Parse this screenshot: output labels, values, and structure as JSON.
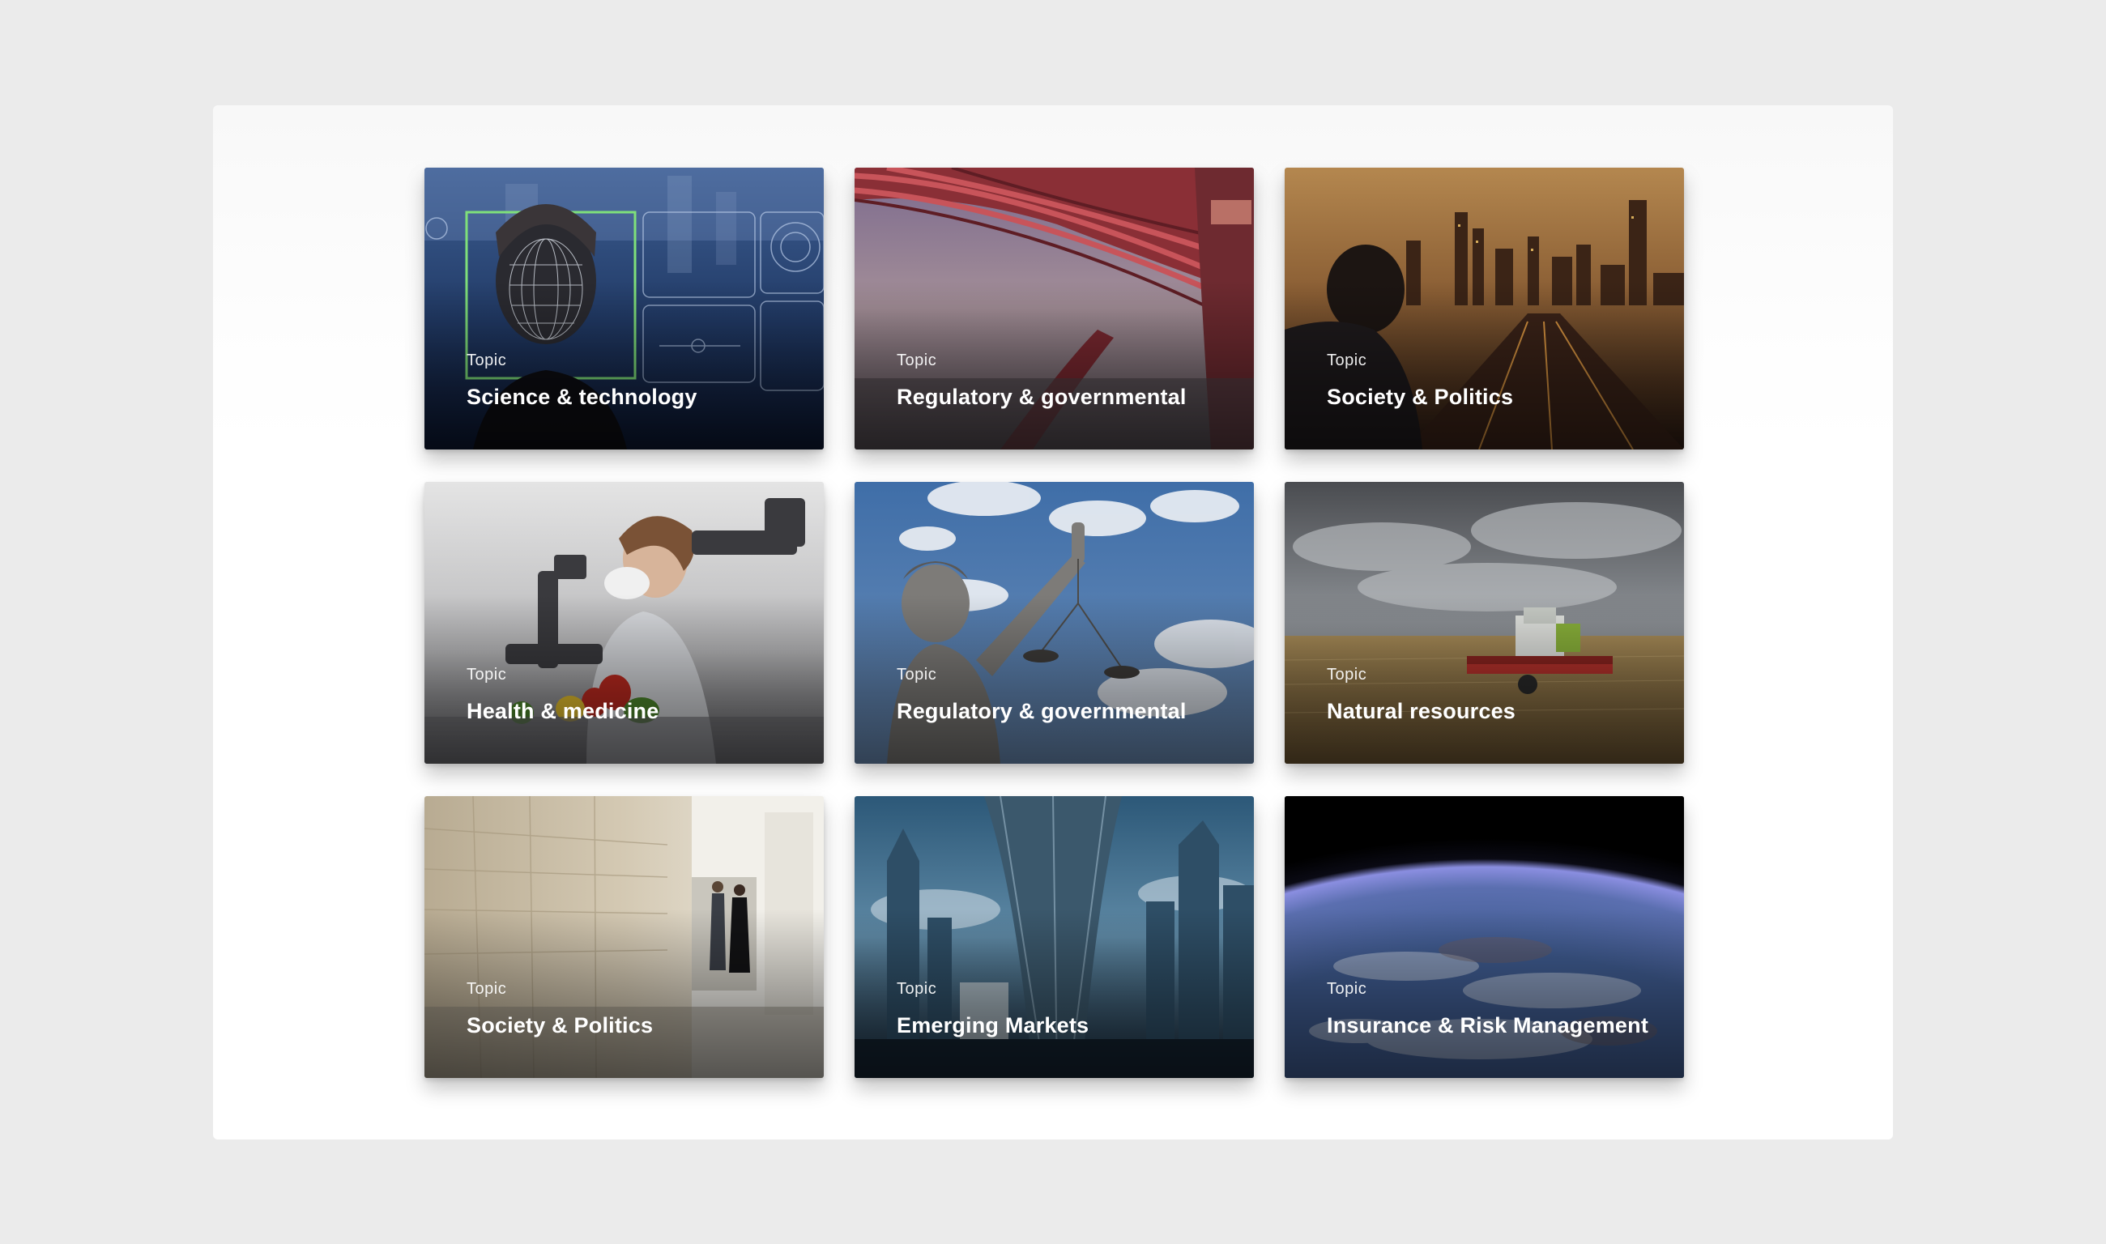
{
  "cards": [
    {
      "label": "Topic",
      "title": "Science & technology"
    },
    {
      "label": "Topic",
      "title": "Regulatory & governmental"
    },
    {
      "label": "Topic",
      "title": "Society & Politics"
    },
    {
      "label": "Topic",
      "title": "Health & medicine"
    },
    {
      "label": "Topic",
      "title": "Regulatory & governmental"
    },
    {
      "label": "Topic",
      "title": "Natural resources"
    },
    {
      "label": "Topic",
      "title": "Society & Politics"
    },
    {
      "label": "Topic",
      "title": "Emerging Markets"
    },
    {
      "label": "Topic",
      "title": "Insurance & Risk Management"
    }
  ]
}
